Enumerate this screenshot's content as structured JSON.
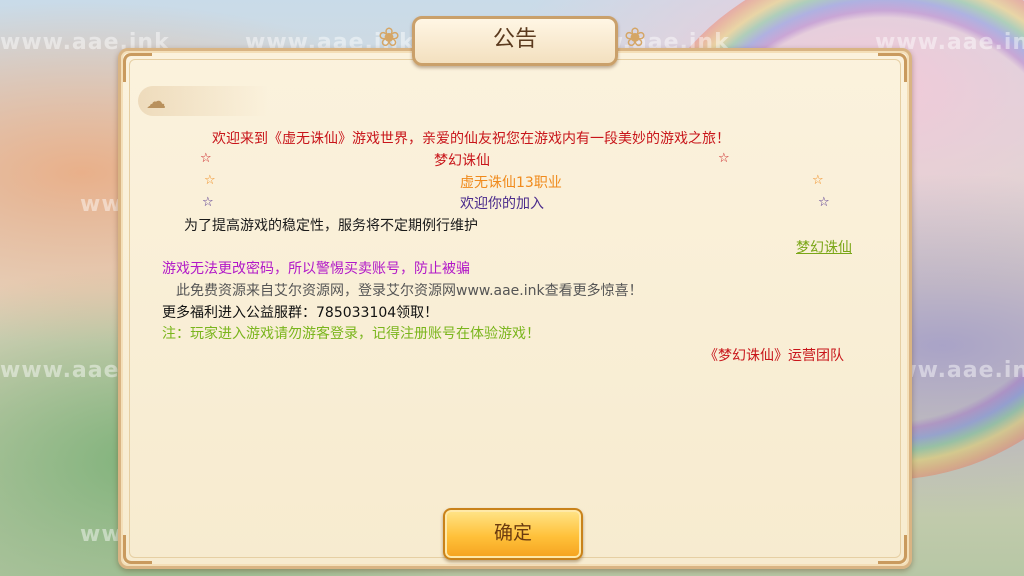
{
  "watermark": "www.aae.ink",
  "dialog": {
    "title": "公告",
    "lines": {
      "welcome": "欢迎来到《虚无诛仙》游戏世界，亲爱的仙友祝您在游戏内有一段美妙的游戏之旅！",
      "game_name": "梦幻诛仙",
      "jobs": "虚无诛仙13职业",
      "join": "欢迎你的加入",
      "maintenance": "为了提高游戏的稳定性，服务将不定期例行维护",
      "link": "梦幻诛仙",
      "warning": "游戏无法更改密码，所以警惕买卖账号，防止被骗",
      "source": "此免费资源来自艾尔资源网，登录艾尔资源网www.aae.ink查看更多惊喜！",
      "group": "更多福利进入公益服群：785033104领取！",
      "note": "注：玩家进入游戏请勿游客登录，记得注册账号在体验游戏！",
      "team": "《梦幻诛仙》运营团队"
    },
    "star_glyph": "☆",
    "confirm_button": "确定"
  },
  "colors": {
    "welcome": "#c8151a",
    "game_name": "#c8151a",
    "jobs": "#f08a1c",
    "join": "#4a2b8c",
    "maintenance": "#1a1a1a",
    "link": "#7aa617",
    "warning": "#b219c8",
    "source": "#555555",
    "group": "#111111",
    "note": "#7ab51c",
    "team": "#c8151a"
  }
}
